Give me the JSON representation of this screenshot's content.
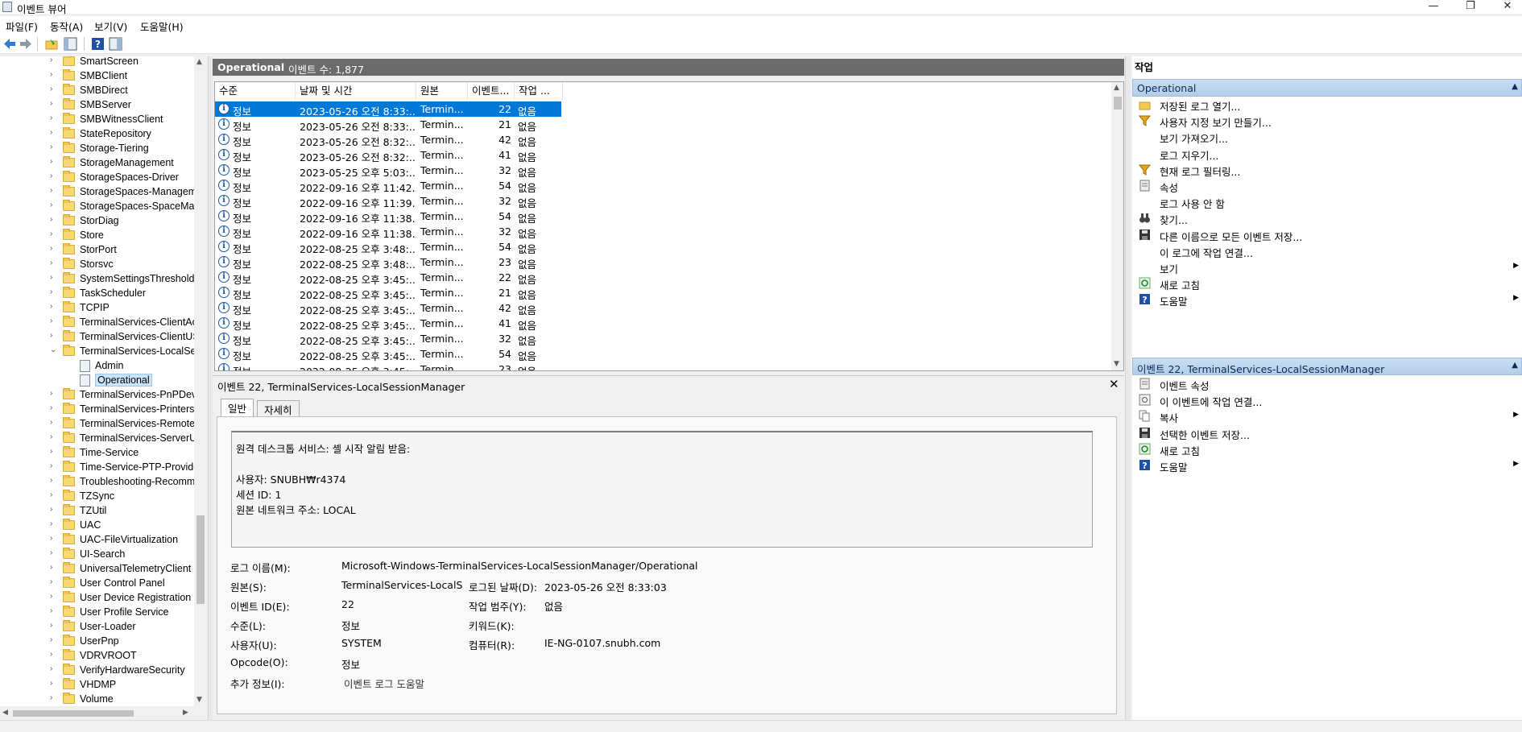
{
  "window": {
    "title": "이벤트 뷰어",
    "controls": [
      "—",
      "❐",
      "✕"
    ]
  },
  "menubar": [
    "파일(F)",
    "동작(A)",
    "보기(V)",
    "도움말(H)"
  ],
  "tree": {
    "items": [
      {
        "label": "SmartScreen"
      },
      {
        "label": "SMBClient"
      },
      {
        "label": "SMBDirect"
      },
      {
        "label": "SMBServer"
      },
      {
        "label": "SMBWitnessClient"
      },
      {
        "label": "StateRepository"
      },
      {
        "label": "Storage-Tiering"
      },
      {
        "label": "StorageManagement"
      },
      {
        "label": "StorageSpaces-Driver"
      },
      {
        "label": "StorageSpaces-Manageme"
      },
      {
        "label": "StorageSpaces-SpaceMan"
      },
      {
        "label": "StorDiag"
      },
      {
        "label": "Store"
      },
      {
        "label": "StorPort"
      },
      {
        "label": "Storsvc"
      },
      {
        "label": "SystemSettingsThreshold"
      },
      {
        "label": "TaskScheduler"
      },
      {
        "label": "TCPIP"
      },
      {
        "label": "TerminalServices-ClientAc"
      },
      {
        "label": "TerminalServices-ClientUS"
      },
      {
        "label": "TerminalServices-LocalSes",
        "expanded": true
      },
      {
        "label": "Admin",
        "child": true
      },
      {
        "label": "Operational",
        "child": true,
        "selected": true
      },
      {
        "label": "TerminalServices-PnPDevi"
      },
      {
        "label": "TerminalServices-Printers"
      },
      {
        "label": "TerminalServices-RemoteC"
      },
      {
        "label": "TerminalServices-ServerUS"
      },
      {
        "label": "Time-Service"
      },
      {
        "label": "Time-Service-PTP-Provide"
      },
      {
        "label": "Troubleshooting-Recomm"
      },
      {
        "label": "TZSync"
      },
      {
        "label": "TZUtil"
      },
      {
        "label": "UAC"
      },
      {
        "label": "UAC-FileVirtualization"
      },
      {
        "label": "UI-Search"
      },
      {
        "label": "UniversalTelemetryClient"
      },
      {
        "label": "User Control Panel"
      },
      {
        "label": "User Device Registration"
      },
      {
        "label": "User Profile Service"
      },
      {
        "label": "User-Loader"
      },
      {
        "label": "UserPnp"
      },
      {
        "label": "VDRVROOT"
      },
      {
        "label": "VerifyHardwareSecurity"
      },
      {
        "label": "VHDMP"
      },
      {
        "label": "Volume"
      }
    ]
  },
  "center": {
    "log_name": "Operational",
    "count_text": "이벤트 수: 1,877",
    "columns": [
      "수준",
      "날짜 및 시간",
      "원본",
      "이벤트...",
      "작업 ..."
    ],
    "events": [
      {
        "level": "정보",
        "datetime": "2023-05-26 오전 8:33:...",
        "source": "Termin...",
        "id": "22",
        "task": "없음"
      },
      {
        "level": "정보",
        "datetime": "2023-05-26 오전 8:33:...",
        "source": "Termin...",
        "id": "21",
        "task": "없음"
      },
      {
        "level": "정보",
        "datetime": "2023-05-26 오전 8:32:...",
        "source": "Termin...",
        "id": "42",
        "task": "없음"
      },
      {
        "level": "정보",
        "datetime": "2023-05-26 오전 8:32:...",
        "source": "Termin...",
        "id": "41",
        "task": "없음"
      },
      {
        "level": "정보",
        "datetime": "2023-05-25 오후 5:03:...",
        "source": "Termin...",
        "id": "32",
        "task": "없음"
      },
      {
        "level": "정보",
        "datetime": "2022-09-16 오후 11:42...",
        "source": "Termin...",
        "id": "54",
        "task": "없음"
      },
      {
        "level": "정보",
        "datetime": "2022-09-16 오후 11:39...",
        "source": "Termin...",
        "id": "32",
        "task": "없음"
      },
      {
        "level": "정보",
        "datetime": "2022-09-16 오후 11:38...",
        "source": "Termin...",
        "id": "54",
        "task": "없음"
      },
      {
        "level": "정보",
        "datetime": "2022-09-16 오후 11:38...",
        "source": "Termin...",
        "id": "32",
        "task": "없음"
      },
      {
        "level": "정보",
        "datetime": "2022-08-25 오후 3:48:...",
        "source": "Termin...",
        "id": "54",
        "task": "없음"
      },
      {
        "level": "정보",
        "datetime": "2022-08-25 오후 3:48:...",
        "source": "Termin...",
        "id": "23",
        "task": "없음"
      },
      {
        "level": "정보",
        "datetime": "2022-08-25 오후 3:45:...",
        "source": "Termin...",
        "id": "22",
        "task": "없음"
      },
      {
        "level": "정보",
        "datetime": "2022-08-25 오후 3:45:...",
        "source": "Termin...",
        "id": "21",
        "task": "없음"
      },
      {
        "level": "정보",
        "datetime": "2022-08-25 오후 3:45:...",
        "source": "Termin...",
        "id": "42",
        "task": "없음"
      },
      {
        "level": "정보",
        "datetime": "2022-08-25 오후 3:45:...",
        "source": "Termin...",
        "id": "41",
        "task": "없음"
      },
      {
        "level": "정보",
        "datetime": "2022-08-25 오후 3:45:...",
        "source": "Termin...",
        "id": "32",
        "task": "없음"
      },
      {
        "level": "정보",
        "datetime": "2022-08-25 오후 3:45:...",
        "source": "Termin...",
        "id": "54",
        "task": "없음"
      },
      {
        "level": "정보",
        "datetime": "2022-08-25 오후 3:45:...",
        "source": "Termin...",
        "id": "23",
        "task": "없음"
      }
    ]
  },
  "details": {
    "title": "이벤트 22, TerminalServices-LocalSessionManager",
    "tabs": [
      "일반",
      "자세히"
    ],
    "message_lines": [
      "원격 데스크톱 서비스: 셸 시작 알림 받음:",
      "",
      "사용자: SNUBH₩r4374",
      "세션 ID: 1",
      "원본 네트워크 주소: LOCAL"
    ],
    "fields": {
      "log_name_label": "로그 이름(M):",
      "log_name": "Microsoft-Windows-TerminalServices-LocalSessionManager/Operational",
      "source_label": "원본(S):",
      "source": "TerminalServices-LocalSessi",
      "logged_label": "로그된 날짜(D):",
      "logged": "2023-05-26 오전 8:33:03",
      "event_id_label": "이벤트 ID(E):",
      "event_id": "22",
      "task_label": "작업 범주(Y):",
      "task": "없음",
      "level_label": "수준(L):",
      "level": "정보",
      "keywords_label": "키워드(K):",
      "keywords": "",
      "user_label": "사용자(U):",
      "user": "SYSTEM",
      "computer_label": "컴퓨터(R):",
      "computer": "IE-NG-0107.snubh.com",
      "opcode_label": "Opcode(O):",
      "opcode": "정보",
      "more_label": "추가 정보(I):",
      "more_link": "이벤트 로그 도움말"
    }
  },
  "actions": {
    "title": "작업",
    "section1": "Operational",
    "items1": [
      {
        "label": "저장된 로그 열기...",
        "icon": "open-folder-icon"
      },
      {
        "label": "사용자 지정 보기 만들기...",
        "icon": "filter-icon"
      },
      {
        "label": "보기 가져오기...",
        "icon": ""
      },
      {
        "label": "로그 지우기...",
        "icon": ""
      },
      {
        "label": "현재 로그 필터링...",
        "icon": "filter-icon"
      },
      {
        "label": "속성",
        "icon": "properties-icon"
      },
      {
        "label": "로그 사용 안 함",
        "icon": ""
      },
      {
        "label": "찾기...",
        "icon": "binoculars-icon"
      },
      {
        "label": "다른 이름으로 모든 이벤트 저장...",
        "icon": "save-icon"
      },
      {
        "label": "이 로그에 작업 연결...",
        "icon": ""
      },
      {
        "label": "보기",
        "icon": "",
        "submenu": true
      },
      {
        "label": "새로 고침",
        "icon": "refresh-icon"
      },
      {
        "label": "도움말",
        "icon": "help-icon",
        "submenu": true
      }
    ],
    "section2": "이벤트 22, TerminalServices-LocalSessionManager",
    "items2": [
      {
        "label": "이벤트 속성",
        "icon": "properties-icon"
      },
      {
        "label": "이 이벤트에 작업 연결...",
        "icon": "task-icon"
      },
      {
        "label": "복사",
        "icon": "copy-icon",
        "submenu": true
      },
      {
        "label": "선택한 이벤트 저장...",
        "icon": "save-icon"
      },
      {
        "label": "새로 고침",
        "icon": "refresh-icon"
      },
      {
        "label": "도움말",
        "icon": "help-icon",
        "submenu": true
      }
    ]
  }
}
